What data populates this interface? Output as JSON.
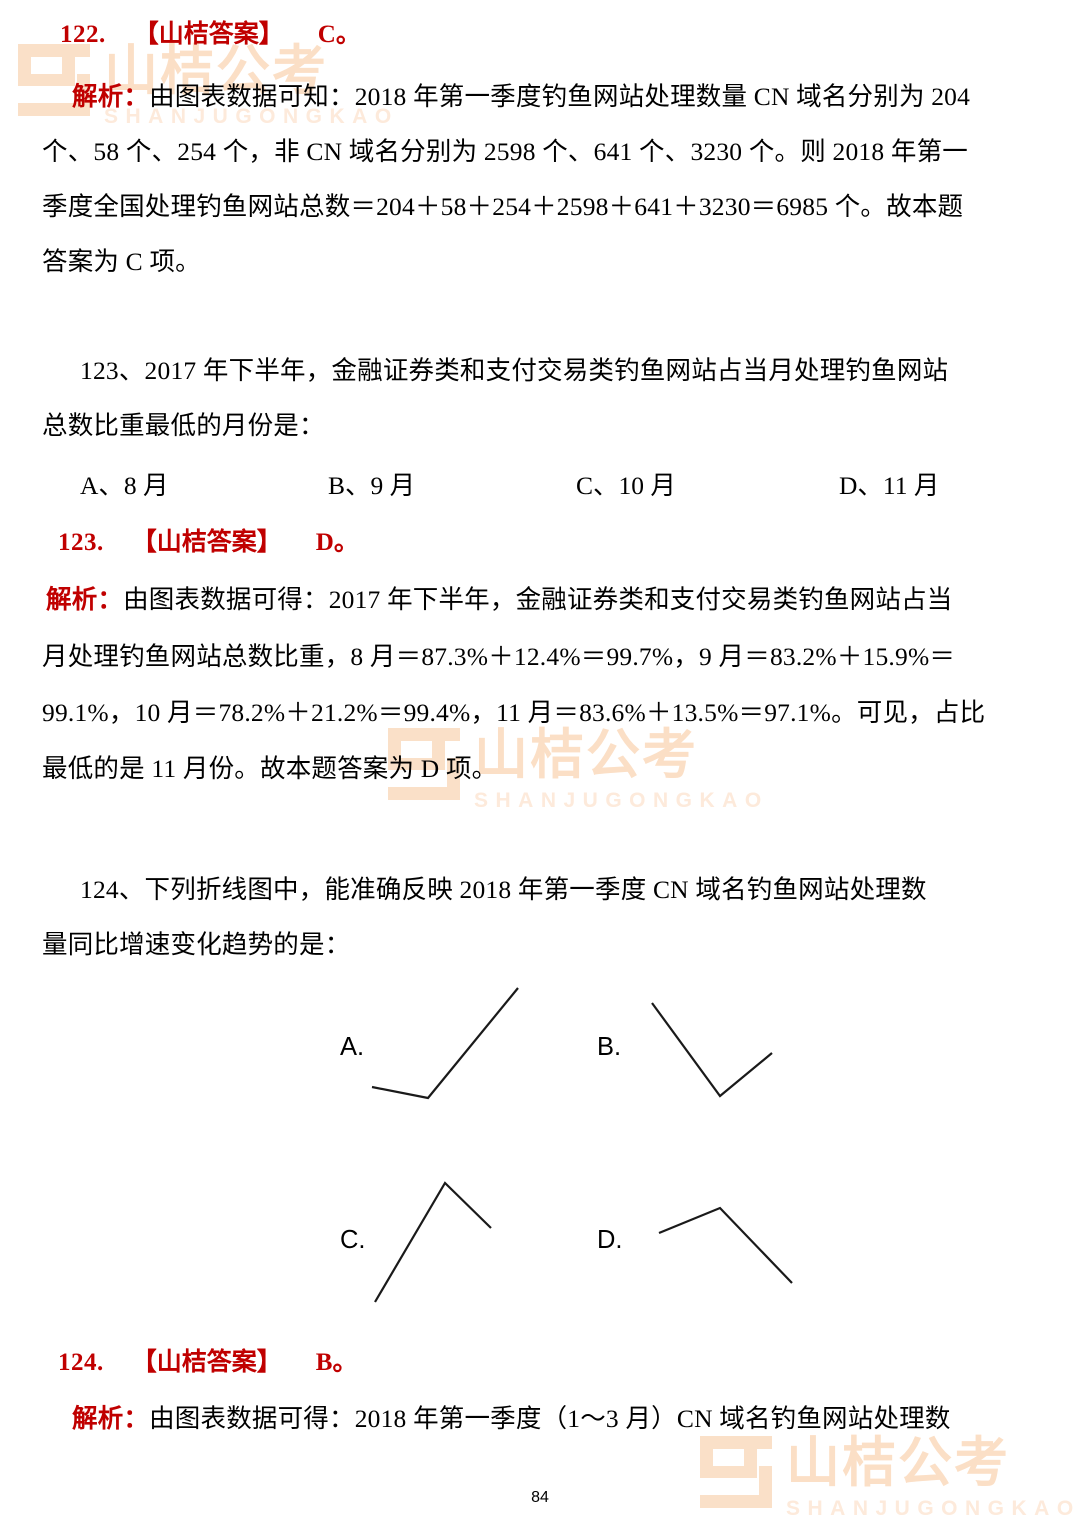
{
  "page": {
    "number": "84",
    "watermark": {
      "cn": "山桔公考",
      "en": "SHANJUGONGKAO",
      "logo_icon": "shanju-logo-icon",
      "color": "#fbdfc6"
    },
    "accent_red": "#c00000"
  },
  "q122_answer": {
    "number": "122.",
    "label": "【山桔答案】",
    "choice": "C。",
    "analysis_label": "解析：",
    "analysis_lines": [
      "由图表数据可知：2018 年第一季度钓鱼网站处理数量 CN 域名分别为 204",
      "个、58 个、254 个，非 CN 域名分别为 2598 个、641 个、3230 个。则 2018 年第一",
      "季度全国处理钓鱼网站总数＝204＋58＋254＋2598＋641＋3230＝6985 个。故本题",
      "答案为 C 项。"
    ]
  },
  "q123": {
    "stem_lines": [
      "123、2017 年下半年，金融证券类和支付交易类钓鱼网站占当月处理钓鱼网站",
      "总数比重最低的月份是："
    ],
    "options": [
      "A、8 月",
      "B、9 月",
      "C、10 月",
      "D、11 月"
    ],
    "answer": {
      "number": "123.",
      "label": "【山桔答案】",
      "choice": "D。"
    },
    "analysis_label": "解析：",
    "analysis_lines": [
      "由图表数据可得：2017 年下半年，金融证券类和支付交易类钓鱼网站占当",
      "月处理钓鱼网站总数比重，8 月＝87.3%＋12.4%＝99.7%，9 月＝83.2%＋15.9%＝",
      "99.1%，10 月＝78.2%＋21.2%＝99.4%，11 月＝83.6%＋13.5%＝97.1%。可见，占比",
      "最低的是 11 月份。故本题答案为 D 项。"
    ]
  },
  "q124": {
    "stem_lines": [
      "124、下列折线图中，能准确反映 2018 年第一季度 CN 域名钓鱼网站处理数",
      "量同比增速变化趋势的是："
    ],
    "options": [
      {
        "label": "A.",
        "shape": "shallow-decline-then-steep-rise"
      },
      {
        "label": "B.",
        "shape": "steep-decline-then-rise"
      },
      {
        "label": "C.",
        "shape": "steep-rise-then-decline"
      },
      {
        "label": "D.",
        "shape": "shallow-rise-then-decline"
      }
    ],
    "answer": {
      "number": "124.",
      "label": "【山桔答案】",
      "choice": "B。"
    },
    "analysis_label": "解析：",
    "analysis_lines": [
      "由图表数据可得：2018 年第一季度（1～3 月）CN 域名钓鱼网站处理数"
    ]
  },
  "chart_data": [
    {
      "type": "line",
      "title": "A",
      "x": [
        1,
        2,
        3
      ],
      "y": [
        30,
        10,
        95
      ],
      "description": "shallow decline then steep rise",
      "grid": false,
      "legend": "none"
    },
    {
      "type": "line",
      "title": "B",
      "x": [
        1,
        2,
        3
      ],
      "y": [
        85,
        5,
        50
      ],
      "description": "steep decline then partial rise",
      "grid": false,
      "legend": "none"
    },
    {
      "type": "line",
      "title": "C",
      "x": [
        1,
        2,
        3
      ],
      "y": [
        5,
        95,
        58
      ],
      "description": "steep rise then decline",
      "grid": false,
      "legend": "none"
    },
    {
      "type": "line",
      "title": "D",
      "x": [
        1,
        2,
        3
      ],
      "y": [
        58,
        75,
        10
      ],
      "description": "shallow rise then steeper decline",
      "grid": false,
      "legend": "none"
    }
  ]
}
